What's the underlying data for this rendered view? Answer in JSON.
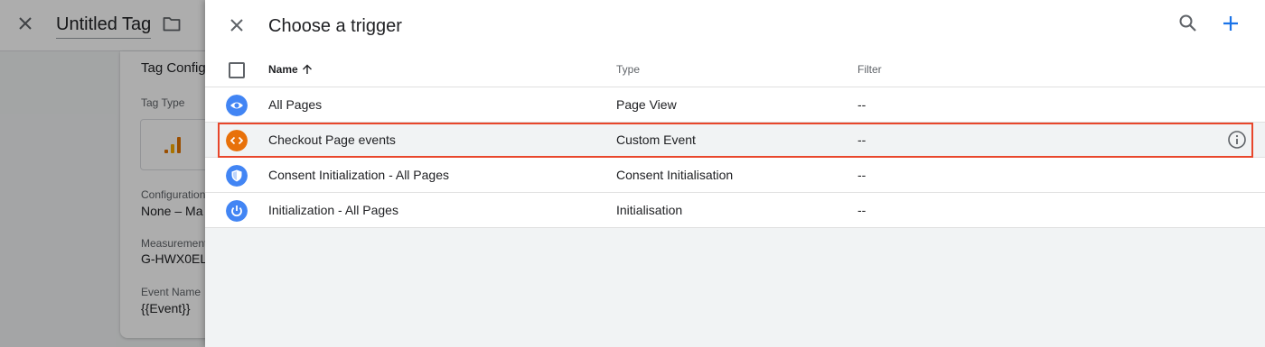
{
  "background": {
    "tag_title": "Untitled Tag",
    "section_title": "Tag Configuration",
    "tag_type_label": "Tag Type",
    "configuration_label": "Configuration",
    "configuration_value": "None – Ma",
    "measurement_label": "Measurement",
    "measurement_value": "G-HWX0EL",
    "event_name_label": "Event Name",
    "event_name_value": "{{Event}}"
  },
  "drawer": {
    "title": "Choose a trigger",
    "columns": {
      "name": "Name",
      "type": "Type",
      "filter": "Filter"
    },
    "rows": [
      {
        "name": "All Pages",
        "type": "Page View",
        "filter": "--",
        "icon": "eye-icon",
        "icon_color": "#4285f4"
      },
      {
        "name": "Checkout Page events",
        "type": "Custom Event",
        "filter": "--",
        "icon": "code-icon",
        "icon_color": "#e8710a"
      },
      {
        "name": "Consent Initialization - All Pages",
        "type": "Consent Initialisation",
        "filter": "--",
        "icon": "shield-icon",
        "icon_color": "#4285f4"
      },
      {
        "name": "Initialization - All Pages",
        "type": "Initialisation",
        "filter": "--",
        "icon": "power-icon",
        "icon_color": "#4285f4"
      }
    ]
  },
  "colors": {
    "accent_blue": "#1a73e8",
    "highlight_border": "#e8462b",
    "custom_event_orange": "#e8710a",
    "trigger_blue": "#4285f4"
  }
}
